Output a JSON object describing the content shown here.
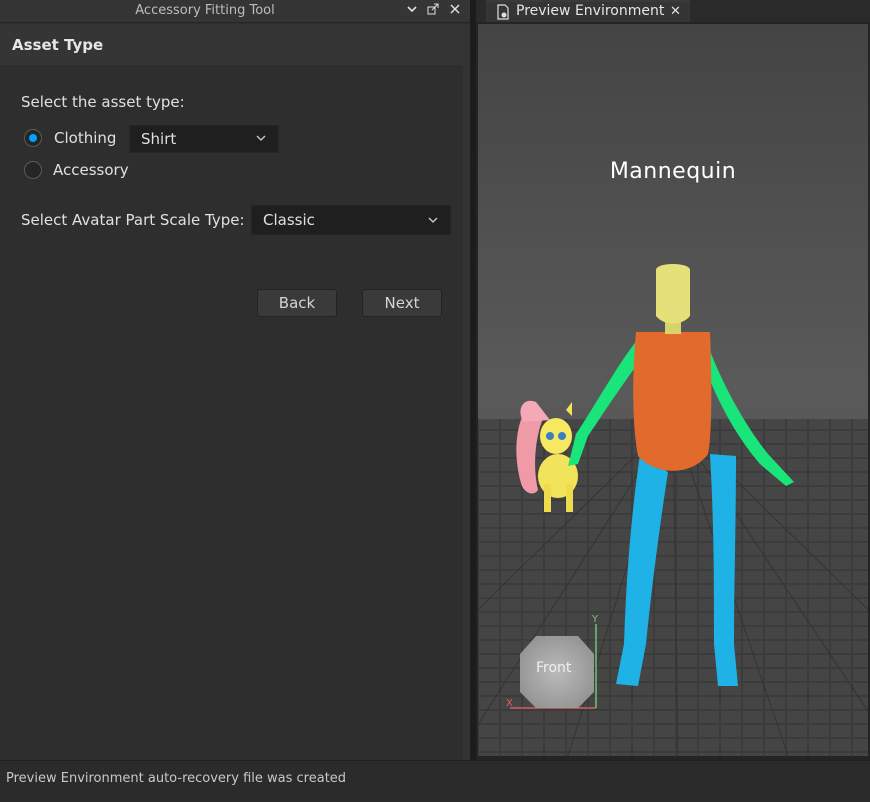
{
  "left_panel": {
    "title": "Accessory Fitting Tool",
    "section_title": "Asset Type",
    "prompt": "Select the asset type:",
    "options": [
      {
        "label": "Clothing",
        "selected": true
      },
      {
        "label": "Accessory",
        "selected": false
      }
    ],
    "clothing_type": "Shirt",
    "scale_label": "Select Avatar Part Scale Type:",
    "scale_value": "Classic",
    "back_label": "Back",
    "next_label": "Next"
  },
  "right_panel": {
    "tab_label": "Preview Environment",
    "close_glyph": "✕",
    "mannequin_label": "Mannequin",
    "view_cube_label": "Front",
    "axis_x": "X",
    "axis_y": "Y"
  },
  "status": "Preview Environment auto-recovery file was created",
  "colors": {
    "accent": "#00a2ff",
    "torso": "#e26a2c",
    "arms": "#19e57a",
    "legs": "#1fb2e6",
    "head": "#e6e07a"
  }
}
